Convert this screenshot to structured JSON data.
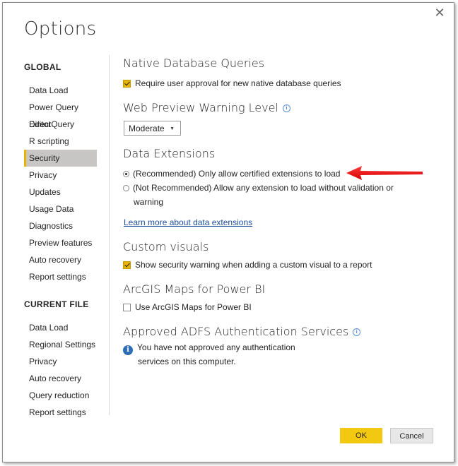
{
  "window": {
    "title": "Options",
    "close_glyph": "✕"
  },
  "sidebar": {
    "global_heading": "GLOBAL",
    "global_items": [
      {
        "label": "Data Load"
      },
      {
        "label": "Power Query Editor"
      },
      {
        "label": "DirectQuery"
      },
      {
        "label": "R scripting"
      },
      {
        "label": "Security",
        "selected": true
      },
      {
        "label": "Privacy"
      },
      {
        "label": "Updates"
      },
      {
        "label": "Usage Data"
      },
      {
        "label": "Diagnostics"
      },
      {
        "label": "Preview features"
      },
      {
        "label": "Auto recovery"
      },
      {
        "label": "Report settings"
      }
    ],
    "current_heading": "CURRENT FILE",
    "current_items": [
      {
        "label": "Data Load"
      },
      {
        "label": "Regional Settings"
      },
      {
        "label": "Privacy"
      },
      {
        "label": "Auto recovery"
      },
      {
        "label": "Query reduction"
      },
      {
        "label": "Report settings"
      }
    ]
  },
  "sections": {
    "native": {
      "title": "Native Database Queries",
      "checkbox_label": "Require user approval for new native database queries",
      "checked": true
    },
    "web_preview": {
      "title": "Web Preview Warning Level",
      "selected": "Moderate"
    },
    "extensions": {
      "title": "Data Extensions",
      "option_recommended": "(Recommended) Only allow certified extensions to load",
      "option_not_recommended_line1": "(Not Recommended) Allow any extension to load without validation or",
      "option_not_recommended_line2": "warning",
      "selected": "recommended",
      "link": "Learn more about data extensions"
    },
    "custom_visuals": {
      "title": "Custom visuals",
      "checkbox_label": "Show security warning when adding a custom visual to a report",
      "checked": true
    },
    "arcgis": {
      "title": "ArcGIS Maps for Power BI",
      "checkbox_label": "Use ArcGIS Maps for Power BI",
      "checked": false
    },
    "adfs": {
      "title": "Approved ADFS Authentication Services",
      "message_line1": "You have not approved any authentication",
      "message_line2": "services on this computer."
    }
  },
  "buttons": {
    "ok": "OK",
    "cancel": "Cancel"
  },
  "colors": {
    "accent": "#f2c811",
    "arrow": "#e8191b",
    "link": "#1f4e99"
  }
}
